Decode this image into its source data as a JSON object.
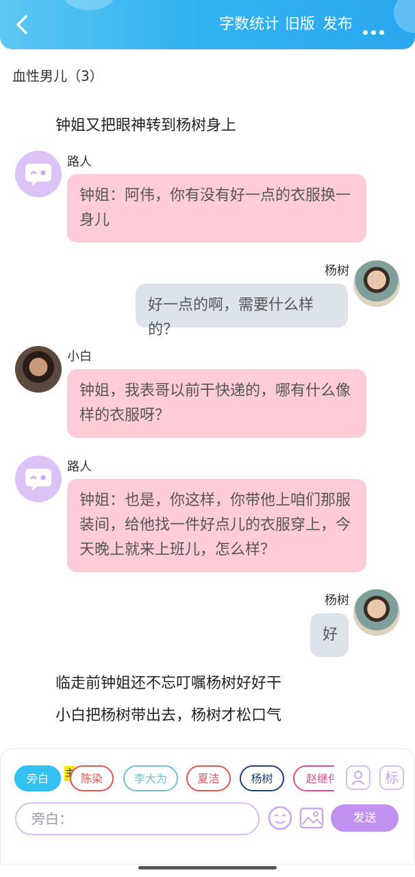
{
  "header": {
    "word_count_label": "字数统计",
    "old_version_label": "旧版",
    "publish_label": "发布"
  },
  "chapter_title": "血性男儿（3）",
  "messages": {
    "narration_1": "钟姐又把眼神转到杨树身上",
    "m1": {
      "name": "路人",
      "line1": "钟姐：阿伟，你有没有好一点的衣服换一",
      "line2": "身儿"
    },
    "m2": {
      "name": "杨树",
      "text": "好一点的啊，需要什么样的？"
    },
    "m3": {
      "name": "小白",
      "line1": "钟姐，我表哥以前干快递的，哪有什么像",
      "line2": "样的衣服呀？"
    },
    "m4": {
      "name": "路人",
      "line1": "钟姐：也是，你这样，你带他上咱们那服",
      "line2": "装间，给他找一件好点儿的衣服穿上，今",
      "line3": "天晚上就来上班儿，怎么样？"
    },
    "m5": {
      "name": "杨树",
      "text": "好"
    },
    "narration_2": "临走前钟姐还不忘叮嘱杨树好好干",
    "narration_3": "小白把杨树带出去，杨树才松口气"
  },
  "composer": {
    "chips": [
      {
        "label": "旁白",
        "color": "#33c2f0"
      },
      {
        "label": "陈染",
        "color": "#e0564f"
      },
      {
        "label": "李大为",
        "color": "#6fbfd0"
      },
      {
        "label": "夏洁",
        "color": "#e0564f"
      },
      {
        "label": "杨树",
        "color": "#1f3f7a"
      },
      {
        "label": "赵继伟",
        "color": "#d84c8a"
      }
    ],
    "main_tag": "主",
    "tool_mark": "标",
    "input_placeholder": "旁白：",
    "send_label": "发送"
  }
}
